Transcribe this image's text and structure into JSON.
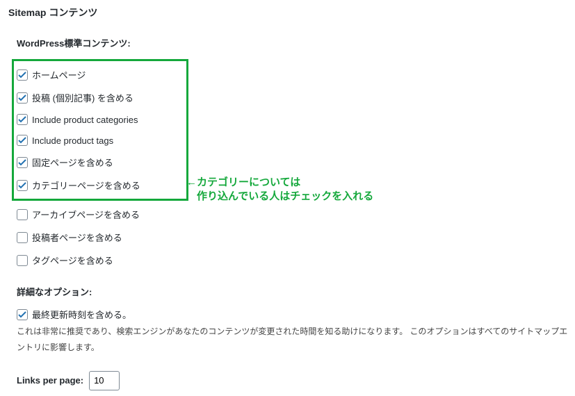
{
  "section_title": "Sitemap コンテンツ",
  "standard": {
    "heading": "WordPress標準コンテンツ:",
    "highlighted": [
      {
        "label": "ホームページ",
        "checked": true
      },
      {
        "label": "投稿 (個別記事) を含める",
        "checked": true
      },
      {
        "label": "Include product categories",
        "checked": true
      },
      {
        "label": "Include product tags",
        "checked": true
      },
      {
        "label": "固定ページを含める",
        "checked": true
      },
      {
        "label": "カテゴリーページを含める",
        "checked": true
      }
    ],
    "rest": [
      {
        "label": "アーカイブページを含める",
        "checked": false
      },
      {
        "label": "投稿者ページを含める",
        "checked": false
      },
      {
        "label": "タグページを含める",
        "checked": false
      }
    ]
  },
  "annotation": {
    "line1": "←カテゴリーについては",
    "line2": "　作り込んでいる人はチェックを入れる"
  },
  "advanced": {
    "heading": "詳細なオプション:",
    "lastmod": {
      "label": "最終更新時刻を含める。",
      "checked": true
    },
    "helper": "これは非常に推奨であり、検索エンジンがあなたのコンテンツが変更された時間を知る助けになります。 このオプションはすべてのサイトマップエントリに影響します。"
  },
  "links_per_page": {
    "label": "Links per page:",
    "value": "10"
  }
}
